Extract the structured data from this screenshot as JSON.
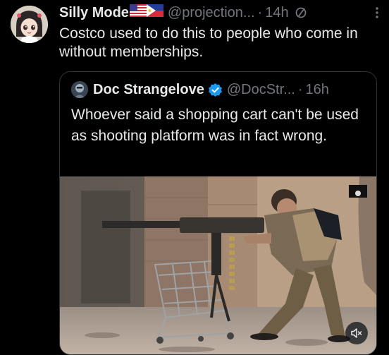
{
  "tweet": {
    "author_name": "Silly Mode",
    "handle": "@projection...",
    "dot": "·",
    "time": "14h",
    "text": "Costco used to do this to people who come in without memberships."
  },
  "quoted_tweet": {
    "author_name": "Doc Strangelove",
    "handle": "@DocStr...",
    "dot": "·",
    "time": "16h",
    "text": "Whoever said a shopping cart can't be used as shooting platform was in fact wrong."
  },
  "icons": {
    "flags": [
      "us-flag-icon",
      "philippines-flag-icon"
    ],
    "edited": "edited-icon",
    "more": "more-icon",
    "verified": "verified-badge-icon",
    "mute": "speaker-muted-icon"
  },
  "colors": {
    "background": "#000000",
    "text_primary": "#e7e9ea",
    "text_muted": "#71767b",
    "verified_blue": "#1d9bf0",
    "card_border": "#2f3336"
  }
}
